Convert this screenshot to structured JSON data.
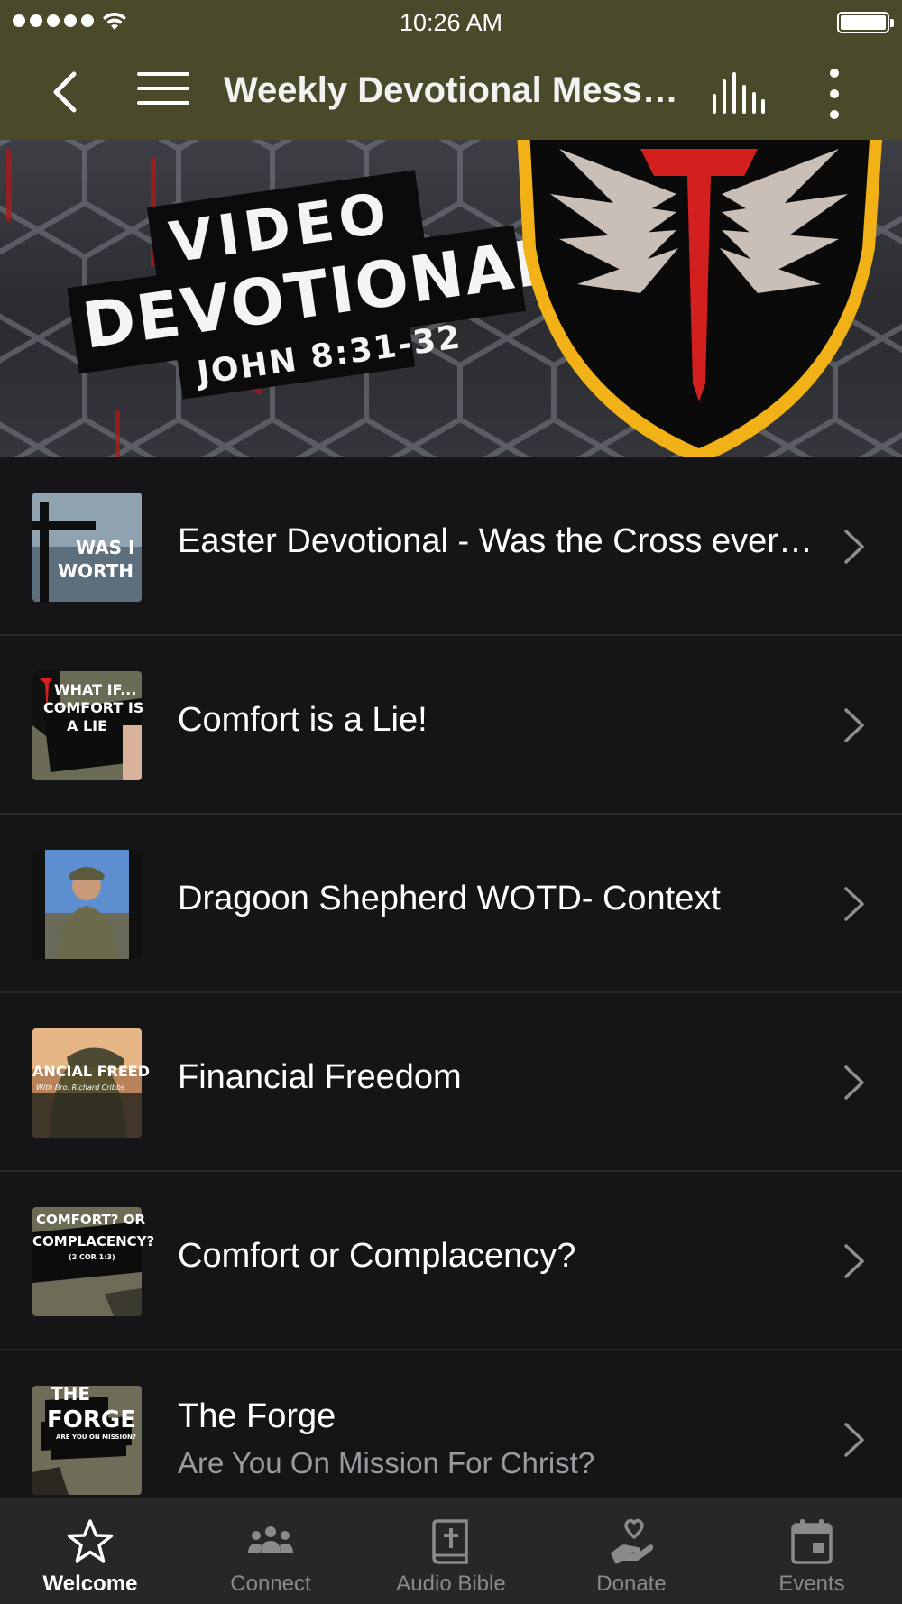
{
  "status_bar": {
    "time": "10:26 AM",
    "signal_bars": 5,
    "battery_level": 1.0
  },
  "nav": {
    "title": "Weekly Devotional Messages",
    "back_icon": "chevron-left-icon",
    "menu_icon": "hamburger-icon",
    "audio_icon": "equalizer-icon",
    "more_icon": "more-vertical-icon"
  },
  "banner": {
    "line1": "VIDEO",
    "line2": "DEVOTIONALS",
    "line3": "JOHN 8:31-32"
  },
  "list": {
    "items": [
      {
        "title": "Easter Devotional - Was the Cross every bit worth it?",
        "subtitle": "",
        "thumb_text": [
          "WAS I",
          "WORTH"
        ]
      },
      {
        "title": "Comfort is a Lie!",
        "subtitle": "",
        "thumb_text": [
          "WHAT IF...",
          "COMFORT IS",
          "A LIE"
        ]
      },
      {
        "title": "Dragoon Shepherd WOTD- Context",
        "subtitle": "",
        "thumb_text": []
      },
      {
        "title": "Financial Freedom",
        "subtitle": "",
        "thumb_text": [
          "ANCIAL FREED",
          "With Bro. Richard Cribbs"
        ]
      },
      {
        "title": "Comfort or Complacency?",
        "subtitle": "",
        "thumb_text": [
          "COMFORT? OR",
          "COMPLACENCY?",
          "(2 COR 1:3)"
        ]
      },
      {
        "title": "The Forge",
        "subtitle": "Are You On Mission For Christ?",
        "thumb_text": [
          "THE",
          "FORGE",
          "ARE YOU ON MISSION?"
        ]
      }
    ]
  },
  "tabs": [
    {
      "label": "Welcome",
      "icon": "star-icon",
      "active": true
    },
    {
      "label": "Connect",
      "icon": "group-icon",
      "active": false
    },
    {
      "label": "Audio Bible",
      "icon": "bible-icon",
      "active": false
    },
    {
      "label": "Donate",
      "icon": "donate-hand-heart-icon",
      "active": false
    },
    {
      "label": "Events",
      "icon": "calendar-icon",
      "active": false
    }
  ],
  "colors": {
    "header_bg": "#4a4a2b",
    "list_bg": "#151518",
    "tab_bar_bg": "#27272a",
    "accent_red": "#d41f1f",
    "shield_gold": "#f2b116"
  }
}
